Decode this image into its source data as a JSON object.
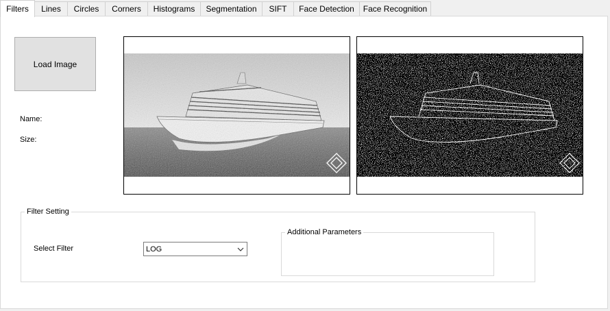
{
  "tabs": [
    {
      "label": "Filters",
      "active": true
    },
    {
      "label": "Lines",
      "active": false
    },
    {
      "label": "Circles",
      "active": false
    },
    {
      "label": "Corners",
      "active": false
    },
    {
      "label": "Histograms",
      "active": false
    },
    {
      "label": "Segmentation",
      "active": false
    },
    {
      "label": "SIFT",
      "active": false
    },
    {
      "label": "Face Detection",
      "active": false
    },
    {
      "label": "Face Recognition",
      "active": false
    }
  ],
  "filters": {
    "load_button": "Load Image",
    "name_label": "Name:",
    "size_label": "Size:",
    "filter_setting": {
      "title": "Filter Setting",
      "select_label": "Select Filter",
      "selected_filter": "LOG",
      "additional_params_title": "Additional Parameters"
    }
  },
  "colors": {
    "panel_bg": "#ffffff",
    "window_bg": "#f0f0f0",
    "button_bg": "#e1e1e1"
  }
}
